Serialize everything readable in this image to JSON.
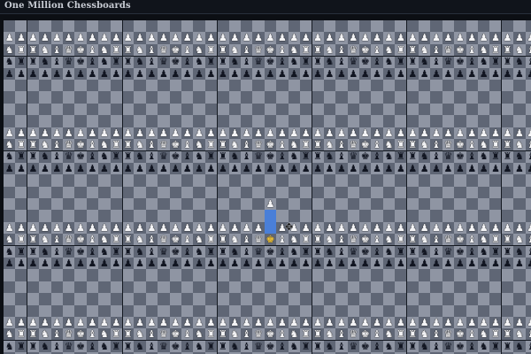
{
  "app": {
    "title": "One Million Chessboards"
  },
  "board_view": {
    "icons": {
      "pawn": "chess-pawn-icon",
      "rook": "chess-rook-icon",
      "knight": "chess-knight-icon",
      "bishop": "chess-bishop-icon",
      "queen": "chess-queen-icon",
      "king": "chess-king-icon",
      "cursor": "move-cursor-icon"
    },
    "glyphs": {
      "pawn": "♟",
      "rook": "♜",
      "knight": "♞",
      "bishop": "♝",
      "queen": "♛",
      "king": "♚",
      "cursor": "✥"
    },
    "colors": {
      "light_square": "#8f95a3",
      "dark_square": "#5f6675",
      "highlight": "#4a7fd8",
      "selected_piece": "#f0c43c",
      "white_piece": "#f4f4f6",
      "black_piece": "#111521"
    },
    "selected": {
      "piece": "queen",
      "color": "white",
      "note": ""
    },
    "back_rank": [
      "rook",
      "knight",
      "bishop",
      "queen",
      "king",
      "bishop",
      "knight",
      "rook"
    ]
  }
}
